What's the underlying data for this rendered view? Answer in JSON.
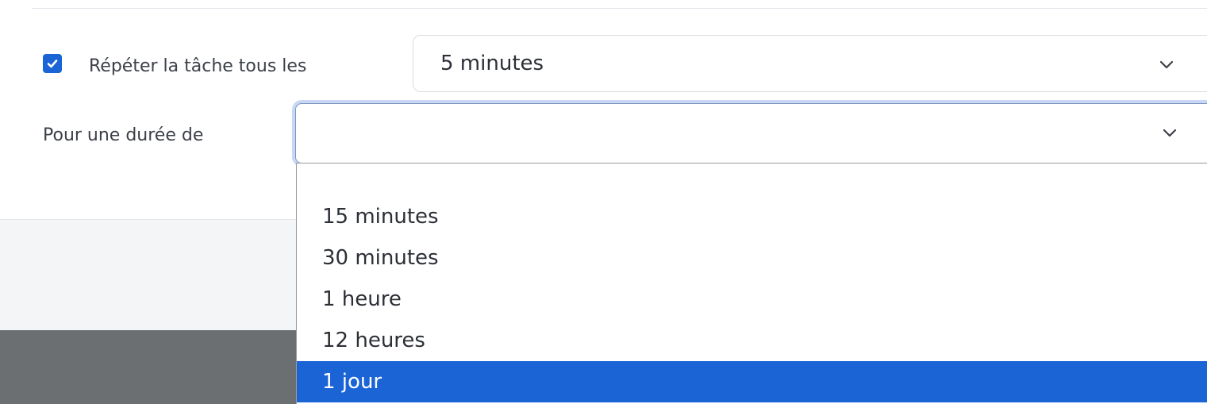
{
  "colors": {
    "accent": "#1a64d6",
    "text": "#3c4048",
    "focus_ring": "#c8d8f4",
    "dark_overlay": "#6c6f72"
  },
  "repeat": {
    "checked": true,
    "label": "Répéter la tâche tous les",
    "interval_value": "5 minutes",
    "interval_icon": "chevron-down-icon"
  },
  "duration": {
    "label": "Pour une durée de",
    "value": "",
    "icon": "chevron-down-icon",
    "options": [
      {
        "label": "15 minutes",
        "selected": false
      },
      {
        "label": "30 minutes",
        "selected": false
      },
      {
        "label": "1 heure",
        "selected": false
      },
      {
        "label": "12 heures",
        "selected": false
      },
      {
        "label": "1 jour",
        "selected": true
      }
    ]
  }
}
